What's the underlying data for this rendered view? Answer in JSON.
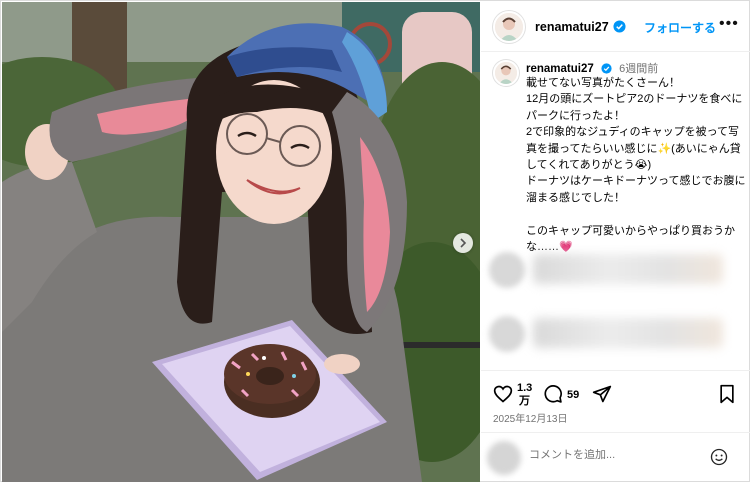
{
  "post": {
    "username": "renamatui27",
    "follow_label": "フォローする",
    "more_label": "•••",
    "time_ago": "6週間前",
    "caption": "載せてない写真がたくさーん！\n12月の頭にズートピア2のドーナツを食べにパークに行ったよ！\n2で印象的なジュディのキャップを被って写真を撮ってたらいい感じに✨(あいにゃん貸してくれてありがとう😭)\nドーナツはケーキドーナツって感じでお腹に溜まる感じでした！\n\nこのキャップ可愛いからやっぱり買おうかな……💗",
    "likes_count_line1": "1.3",
    "likes_count_line2": "万",
    "comments_count": "59",
    "date": "2025年12月13日"
  },
  "comment_box": {
    "placeholder": "コメントを追加..."
  },
  "icons": {
    "like": "heart-icon",
    "comment": "comment-bubble-icon",
    "share": "paper-plane-icon",
    "save": "bookmark-icon",
    "emoji": "smiley-icon",
    "verified": "verified-badge-icon",
    "carousel_next": "chevron-right-icon"
  },
  "colors": {
    "accent": "#0095f6",
    "muted": "#737373",
    "border": "#dbdbdb"
  }
}
